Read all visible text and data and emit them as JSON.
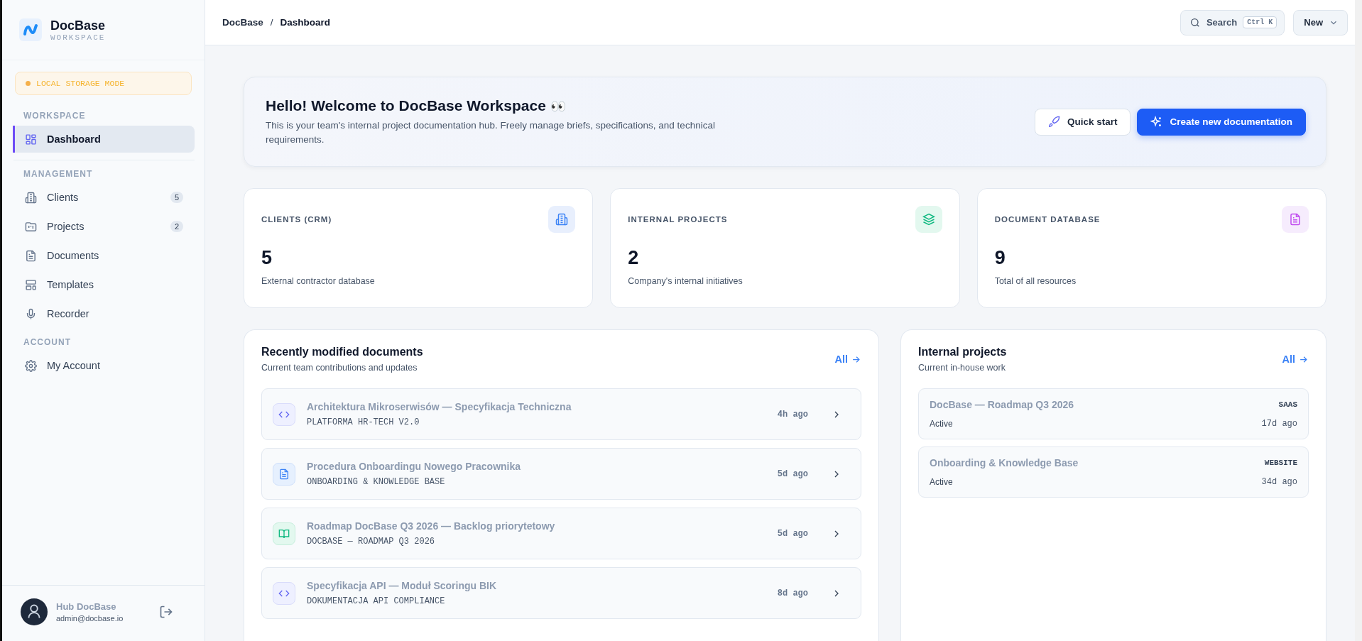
{
  "brand": {
    "name": "DocBase",
    "subtitle": "WORKSPACE"
  },
  "storage_badge": "LOCAL STORAGE MODE",
  "sidebar": {
    "sections": [
      {
        "label": "WORKSPACE",
        "items": [
          {
            "label": "Dashboard",
            "kind": "grid",
            "selected": true
          }
        ]
      },
      {
        "label": "MANAGEMENT",
        "items": [
          {
            "label": "Clients",
            "kind": "building",
            "badge": "5",
            "selected": false
          },
          {
            "label": "Projects",
            "kind": "folder",
            "badge": "2",
            "selected": false
          },
          {
            "label": "Documents",
            "kind": "file",
            "selected": false
          },
          {
            "label": "Templates",
            "kind": "layout",
            "selected": false
          },
          {
            "label": "Recorder",
            "kind": "mic",
            "selected": false
          }
        ]
      },
      {
        "label": "ACCOUNT",
        "items": [
          {
            "label": "My Account",
            "kind": "gear",
            "selected": false
          }
        ]
      }
    ]
  },
  "user": {
    "name": "Hub DocBase",
    "email": "admin@docbase.io"
  },
  "breadcrumb": {
    "separator": "/",
    "items": [
      "DocBase",
      "Dashboard"
    ]
  },
  "search": {
    "label": "Search",
    "shortcut": "Ctrl K"
  },
  "new_button": "New",
  "hero": {
    "title": "Hello! Welcome to DocBase Workspace",
    "emoji": "👀",
    "text": "This is your team's internal project documentation hub. Freely manage briefs, specifications, and technical requirements.",
    "secondary_button": "Quick start",
    "primary_button": "Create new documentation"
  },
  "stats": [
    {
      "label": "CLIENTS (CRM)",
      "value": "5",
      "caption": "External contractor database",
      "kind": "building"
    },
    {
      "label": "INTERNAL PROJECTS",
      "value": "2",
      "caption": "Company's internal initiatives",
      "kind": "layers"
    },
    {
      "label": "DOCUMENT DATABASE",
      "value": "9",
      "caption": "Total of all resources",
      "kind": "file"
    }
  ],
  "documents_panel": {
    "title": "Recently modified documents",
    "subtitle": "Current team contributions and updates",
    "link": "All",
    "rows": [
      {
        "title": "Architektura Mikroserwisów — Specyfikacja Techniczna",
        "project": "PLATFORMA HR-TECH V2.0",
        "time": "4h ago",
        "kind": "code"
      },
      {
        "title": "Procedura Onboardingu Nowego Pracownika",
        "project": "ONBOARDING & KNOWLEDGE BASE",
        "time": "5d ago",
        "kind": "file"
      },
      {
        "title": "Roadmap DocBase Q3 2026 — Backlog priorytetowy",
        "project": "DOCBASE — ROADMAP Q3 2026",
        "time": "5d ago",
        "kind": "book"
      },
      {
        "title": "Specyfikacja API — Moduł Scoringu BIK",
        "project": "DOKUMENTACJA API COMPLIANCE",
        "time": "8d ago",
        "kind": "code"
      }
    ]
  },
  "projects_panel": {
    "title": "Internal projects",
    "subtitle": "Current in-house work",
    "link": "All",
    "rows": [
      {
        "title": "DocBase — Roadmap Q3 2026",
        "type": "SAAS",
        "status": "Active",
        "time": "17d ago"
      },
      {
        "title": "Onboarding & Knowledge Base",
        "type": "WEBSITE",
        "status": "Active",
        "time": "34d ago"
      }
    ]
  }
}
